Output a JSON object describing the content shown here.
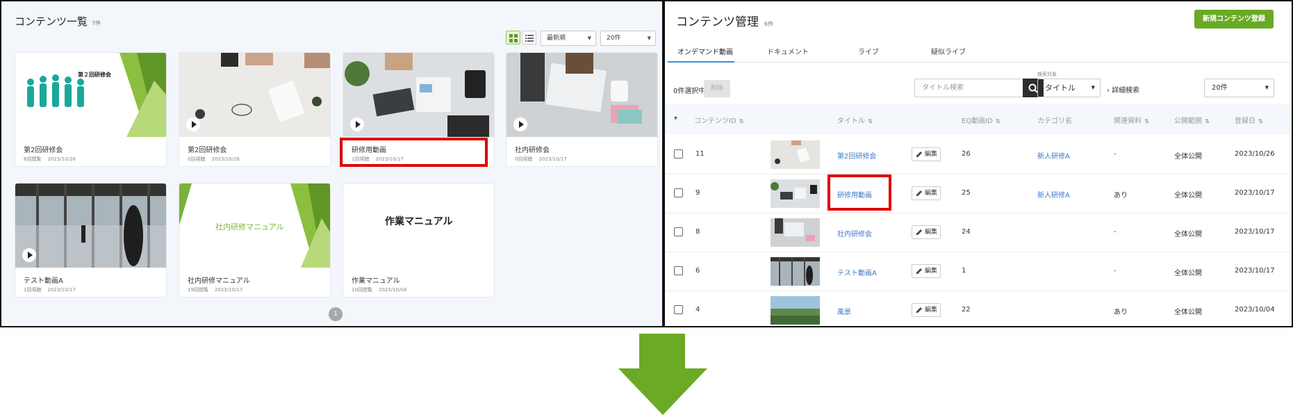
{
  "left": {
    "title": "コンテンツ一覧",
    "count": "7件",
    "sort_label": "最新順",
    "per_page_label": "20件",
    "cards": [
      {
        "title": "第2回研修会",
        "views": "6回閲覧",
        "date": "2023/10/26",
        "thumb_text": "第２回研修会"
      },
      {
        "title": "第2回研修会",
        "views": "0回視聴",
        "date": "2023/10/26"
      },
      {
        "title": "研修用動画",
        "views": "1回視聴",
        "date": "2023/10/17"
      },
      {
        "title": "社内研修会",
        "views": "0回視聴",
        "date": "2023/10/17"
      },
      {
        "title": "テスト動画A",
        "views": "1回視聴",
        "date": "2023/10/17"
      },
      {
        "title": "社内研修マニュアル",
        "views": "19回閲覧",
        "date": "2023/10/17",
        "thumb_text": "社内研修マニュアル"
      },
      {
        "title": "作業マニュアル",
        "views": "10回閲覧",
        "date": "2023/10/04",
        "thumb_text": "作業マニュアル"
      }
    ],
    "page": "1"
  },
  "right": {
    "title": "コンテンツ管理",
    "count": "6件",
    "new_button": "新規コンテンツ登録",
    "tabs": [
      "オンデマンド動画",
      "ドキュメント",
      "ライブ",
      "疑似ライブ"
    ],
    "selected_count": "0件選択中",
    "delete_label": "削除",
    "search_placeholder": "タイトル検索",
    "search_target_label": "検索対象",
    "search_target_value": "タイトル",
    "advanced_search": "詳細検索",
    "per_page_label": "20件",
    "columns": [
      "コンテンツID",
      "タイトル",
      "EQ動画ID",
      "カテゴリ名",
      "関連資料",
      "公開範囲",
      "登録日"
    ],
    "edit_label": "編集",
    "rows": [
      {
        "id": "11",
        "title": "第2回研修会",
        "eq_id": "26",
        "category": "新人研修A",
        "related": "-",
        "scope": "全体公開",
        "date": "2023/10/26"
      },
      {
        "id": "9",
        "title": "研修用動画",
        "eq_id": "25",
        "category": "新人研修A",
        "related": "あり",
        "scope": "全体公開",
        "date": "2023/10/17"
      },
      {
        "id": "8",
        "title": "社内研修会",
        "eq_id": "24",
        "category": "",
        "related": "-",
        "scope": "全体公開",
        "date": "2023/10/17"
      },
      {
        "id": "6",
        "title": "テスト動画A",
        "eq_id": "1",
        "category": "",
        "related": "-",
        "scope": "全体公開",
        "date": "2023/10/17"
      },
      {
        "id": "4",
        "title": "風景",
        "eq_id": "22",
        "category": "",
        "related": "あり",
        "scope": "全体公開",
        "date": "2023/10/04"
      }
    ]
  },
  "colors": {
    "accent_green": "#6aaa24",
    "link_blue": "#3e78c5",
    "highlight_red": "#e00000",
    "tab_blue": "#3a8fd6"
  }
}
